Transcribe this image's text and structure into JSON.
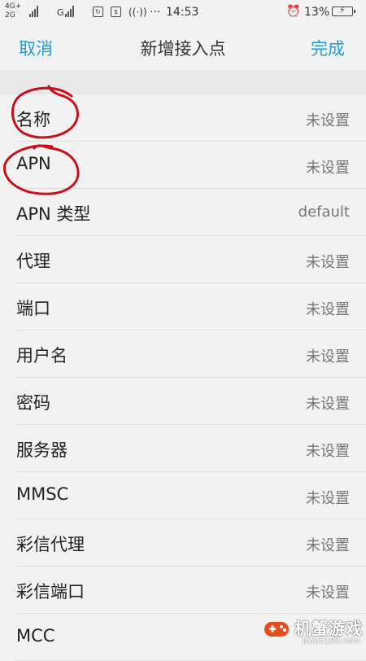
{
  "status_bar": {
    "network_top": "4G+",
    "network_bottom": "2G",
    "carrier_g": "G",
    "time": "14:53",
    "battery": "13%",
    "icons": [
      "signal-icon",
      "signal-icon",
      "sync-icon",
      "sim-icon",
      "wifi-call-icon",
      "more-icon",
      "alarm-icon",
      "battery-charging-icon"
    ]
  },
  "header": {
    "cancel": "取消",
    "title": "新增接入点",
    "done": "完成",
    "accent_color": "#1f9bd8"
  },
  "rows": [
    {
      "label": "名称",
      "value": "未设置"
    },
    {
      "label": "APN",
      "value": "未设置"
    },
    {
      "label": "APN 类型",
      "value": "default"
    },
    {
      "label": "代理",
      "value": "未设置"
    },
    {
      "label": "端口",
      "value": "未设置"
    },
    {
      "label": "用户名",
      "value": "未设置"
    },
    {
      "label": "密码",
      "value": "未设置"
    },
    {
      "label": "服务器",
      "value": "未设置"
    },
    {
      "label": "MMSC",
      "value": "未设置"
    },
    {
      "label": "彩信代理",
      "value": "未设置"
    },
    {
      "label": "彩信端口",
      "value": "未设置"
    },
    {
      "label": "MCC",
      "value": ""
    }
  ],
  "watermark": {
    "title": "机蟹游戏",
    "url": "jixie5188.com"
  }
}
